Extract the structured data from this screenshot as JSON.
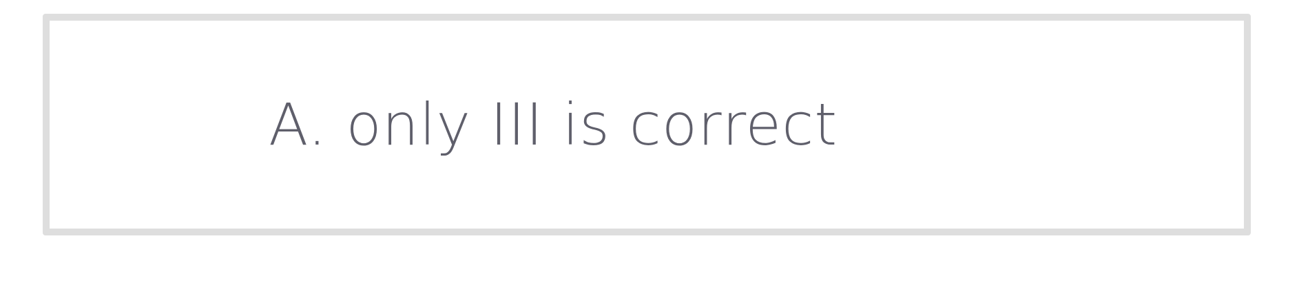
{
  "option": {
    "label": "A. only III is correct"
  },
  "colors": {
    "border": "#dedede",
    "text": "#5f5f6b",
    "background": "#ffffff"
  }
}
